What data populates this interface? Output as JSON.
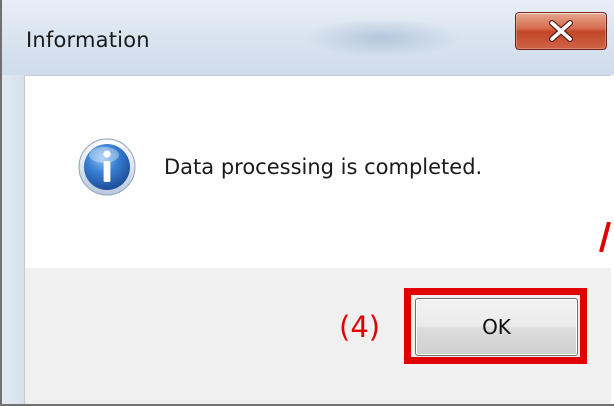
{
  "dialog": {
    "title": "Information",
    "close_glyph": "X",
    "icon": "information-icon",
    "message": "Data processing is completed.",
    "ok_label": "OK"
  },
  "annotation": {
    "step_label": "(4)",
    "color": "#e00000"
  },
  "colors": {
    "titlebar": "#dbe5f1",
    "close_button": "#c2472b",
    "footer": "#f0f0f0",
    "info_icon": "#2f6fc0"
  }
}
